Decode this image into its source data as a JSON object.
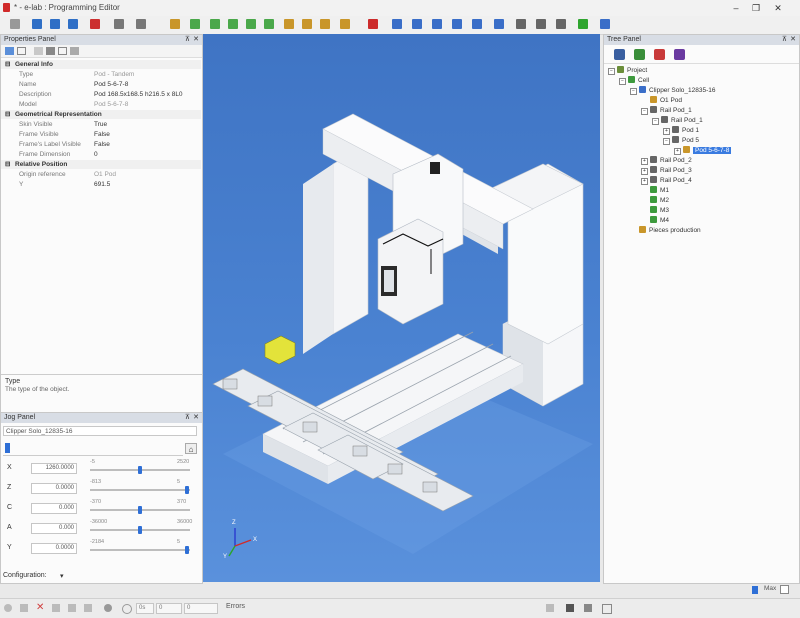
{
  "window": {
    "title": "* - e-lab : Programming Editor",
    "min": "–",
    "max": "❐",
    "close": "✕"
  },
  "toolbar": {
    "colors": [
      "#999999",
      "#2f6fc6",
      "#2f6fc6",
      "#2f6fc6",
      "#cc3030",
      "#777777",
      "#777777",
      "#c9962a",
      "#4aa84a",
      "#4aa84a",
      "#4aa84a",
      "#4aa84a",
      "#4aa84a",
      "#c9962a",
      "#c9962a",
      "#c9962a",
      "#c9962a",
      "#cc2b2b",
      "#3a6ec8",
      "#3a6ec8",
      "#3a6ec8",
      "#3a6ec8",
      "#3a6ec8",
      "#3a6ec8",
      "#666666",
      "#666666",
      "#666666",
      "#2fa52f",
      "#3a6ec8"
    ]
  },
  "properties": {
    "title": "Properties Panel",
    "pin": "⊼",
    "close": "✕",
    "rows": [
      {
        "kind": "cat",
        "label": "General Info"
      },
      {
        "kind": "kv",
        "key": "Type",
        "value": "Pod - Tandem",
        "dim": true
      },
      {
        "kind": "kv",
        "key": "Name",
        "value": "Pod 5-6-7-8"
      },
      {
        "kind": "kv",
        "key": "Description",
        "value": "Pod 168.5x168.5 h216.5 x 8L0"
      },
      {
        "kind": "kv",
        "key": "Model",
        "value": "Pod 5-6-7-8",
        "dim": true
      },
      {
        "kind": "cat",
        "label": "Geometrical Representation"
      },
      {
        "kind": "kv",
        "key": "Skin Visible",
        "value": "True"
      },
      {
        "kind": "kv",
        "key": "Frame Visible",
        "value": "False"
      },
      {
        "kind": "kv",
        "key": "Frame's Label Visible",
        "value": "False"
      },
      {
        "kind": "kv",
        "key": "Frame Dimension",
        "value": "0"
      },
      {
        "kind": "cat",
        "label": "Relative Position"
      },
      {
        "kind": "kv",
        "key": "Origin reference",
        "value": "O1 Pod",
        "dim": true
      },
      {
        "kind": "kv",
        "key": "Y",
        "value": "691.5"
      }
    ],
    "desc_title": "Type",
    "desc_text": "The type of the object."
  },
  "jog": {
    "title": "Jog Panel",
    "pin": "⊼",
    "close": "✕",
    "machine": "Clipper Solo_12835-16",
    "axes": [
      {
        "label": "X",
        "value": "1260.0000",
        "min": "-5",
        "max": "2520",
        "level": 0.5
      },
      {
        "label": "Z",
        "value": "0.0000",
        "min": "-813",
        "max": "5",
        "level": 0.99
      },
      {
        "label": "C",
        "value": "0.000",
        "min": "-370",
        "max": "370",
        "level": 0.5
      },
      {
        "label": "A",
        "value": "0.000",
        "min": "-36000",
        "max": "36000",
        "level": 0.5
      },
      {
        "label": "Y",
        "value": "0.0000",
        "min": "-2184",
        "max": "5",
        "level": 0.99
      }
    ],
    "configuration_label": "Configuration:"
  },
  "tree": {
    "title": "Tree Panel",
    "pin": "⊼",
    "close": "✕",
    "nodes": [
      {
        "depth": 0,
        "exp": "⊟",
        "label": "Project",
        "icon": "#6b8e3a"
      },
      {
        "depth": 1,
        "exp": "⊟",
        "label": "Cell",
        "icon": "#3e9a3e"
      },
      {
        "depth": 2,
        "exp": "⊟",
        "label": "Clipper Solo_12835-16",
        "icon": "#3a6ec8"
      },
      {
        "depth": 3,
        "exp": "",
        "label": "O1 Pod",
        "icon": "#c9962a"
      },
      {
        "depth": 3,
        "exp": "⊟",
        "label": "Rail Pod_1",
        "icon": "#666666"
      },
      {
        "depth": 4,
        "exp": "⊟",
        "label": "Rail Pod_1",
        "icon": "#666666"
      },
      {
        "depth": 5,
        "exp": "⊞",
        "label": "Pod 1",
        "icon": "#666666"
      },
      {
        "depth": 5,
        "exp": "⊟",
        "label": "Pod 5",
        "icon": "#666666"
      },
      {
        "depth": 6,
        "exp": "⊞",
        "label": "Pod 5-6-7-8",
        "icon": "#c9962a",
        "selected": true
      },
      {
        "depth": 3,
        "exp": "⊞",
        "label": "Rail Pod_2",
        "icon": "#666666"
      },
      {
        "depth": 3,
        "exp": "⊞",
        "label": "Rail Pod_3",
        "icon": "#666666"
      },
      {
        "depth": 3,
        "exp": "⊞",
        "label": "Rail Pod_4",
        "icon": "#666666"
      },
      {
        "depth": 3,
        "exp": "",
        "label": "M1",
        "icon": "#3e9a3e"
      },
      {
        "depth": 3,
        "exp": "",
        "label": "M2",
        "icon": "#3e9a3e"
      },
      {
        "depth": 3,
        "exp": "",
        "label": "M3",
        "icon": "#3e9a3e"
      },
      {
        "depth": 3,
        "exp": "",
        "label": "M4",
        "icon": "#3e9a3e"
      },
      {
        "depth": 2,
        "exp": "",
        "label": "Pieces production",
        "icon": "#c9962a"
      }
    ],
    "max_label": "Max"
  },
  "axes_triad": {
    "x": "X",
    "y": "Y",
    "z": "Z"
  },
  "status": {
    "errors_label": "Errors",
    "field1": "0s",
    "field2": "0",
    "field3": "0"
  }
}
